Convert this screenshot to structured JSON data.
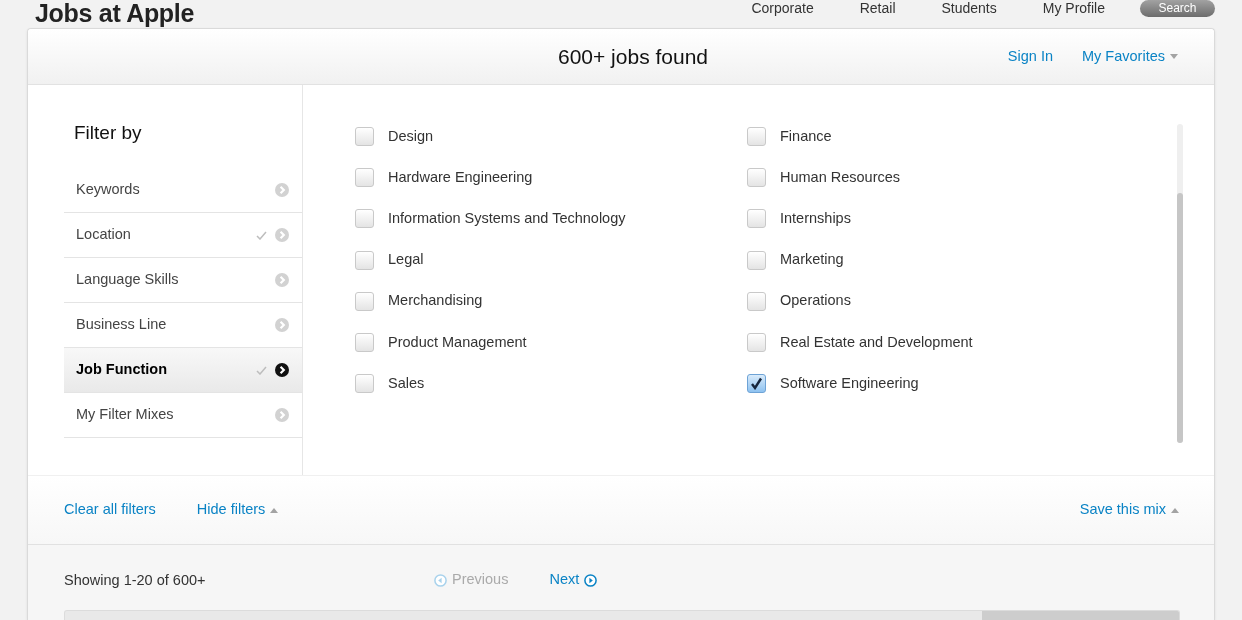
{
  "header": {
    "logo": "Jobs at Apple",
    "nav": [
      {
        "label": "Corporate"
      },
      {
        "label": "Retail"
      },
      {
        "label": "Students"
      },
      {
        "label": "My Profile"
      }
    ],
    "search_button": "Search"
  },
  "results_panel": {
    "title": "600+ jobs found",
    "account_links": [
      {
        "label": "Sign In",
        "kind": "link"
      },
      {
        "label": "My Favorites",
        "kind": "dropdown",
        "expanded": false
      }
    ]
  },
  "filters": {
    "heading": "Filter by",
    "items": [
      {
        "label": "Keywords",
        "selected": false,
        "checked": false
      },
      {
        "label": "Location",
        "selected": false,
        "checked": true
      },
      {
        "label": "Language Skills",
        "selected": false,
        "checked": false
      },
      {
        "label": "Business Line",
        "selected": false,
        "checked": false
      },
      {
        "label": "Job Function",
        "selected": true,
        "checked": true
      },
      {
        "label": "My Filter Mixes",
        "selected": false,
        "checked": false
      }
    ]
  },
  "options": [
    {
      "label": "Design",
      "checked": false
    },
    {
      "label": "Finance",
      "checked": false
    },
    {
      "label": "Hardware Engineering",
      "checked": false
    },
    {
      "label": "Human Resources",
      "checked": false
    },
    {
      "label": "Information Systems and Technology",
      "checked": false
    },
    {
      "label": "Internships",
      "checked": false
    },
    {
      "label": "Legal",
      "checked": false
    },
    {
      "label": "Marketing",
      "checked": false
    },
    {
      "label": "Merchandising",
      "checked": false
    },
    {
      "label": "Operations",
      "checked": false
    },
    {
      "label": "Product Management",
      "checked": false
    },
    {
      "label": "Real Estate and Development",
      "checked": false
    },
    {
      "label": "Sales",
      "checked": false
    },
    {
      "label": "Software Engineering",
      "checked": true
    }
  ],
  "filter_footer": {
    "links": [
      {
        "label": "Clear all filters",
        "kind": "link"
      },
      {
        "label": "Hide filters",
        "kind": "dropdown",
        "expanded": true
      }
    ],
    "save_link": {
      "label": "Save this mix",
      "kind": "dropdown",
      "expanded": true
    }
  },
  "pagination": {
    "summary": "Showing 1-20 of 600+",
    "buttons": [
      {
        "kind": "previous",
        "label": "Previous",
        "disabled": true
      },
      {
        "kind": "next",
        "label": "Next",
        "disabled": false
      }
    ]
  }
}
